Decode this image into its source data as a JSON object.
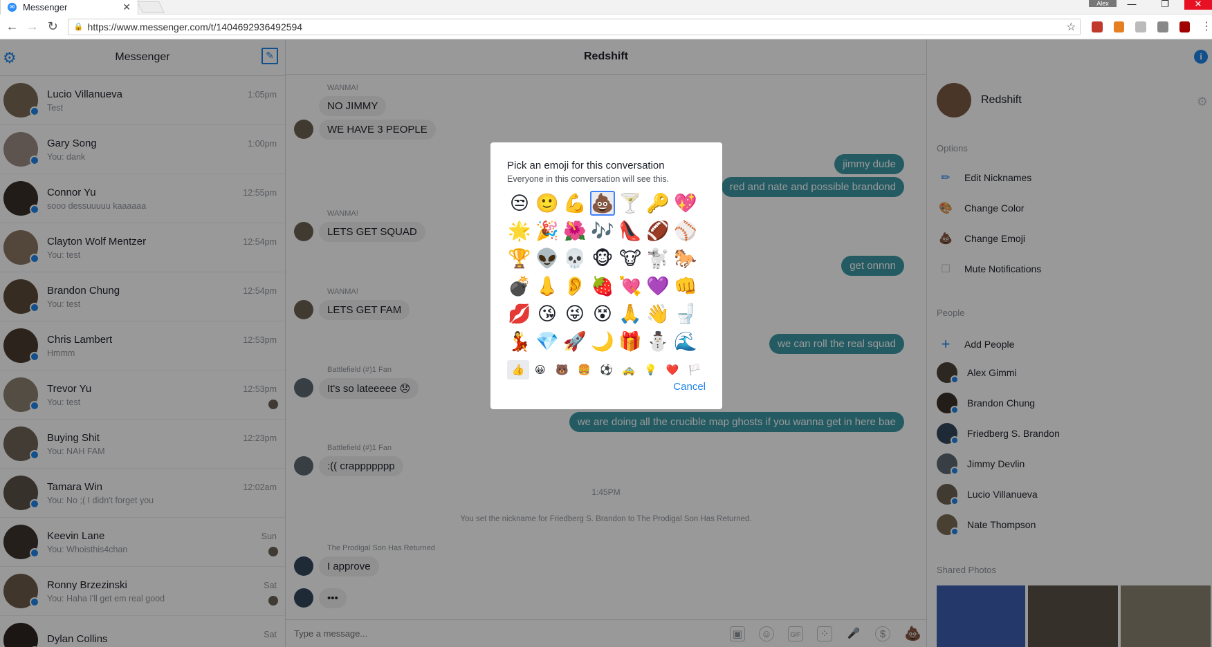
{
  "browser": {
    "tab_title": "Messenger",
    "profile_label": "Alex",
    "url": "https://www.messenger.com/t/1404692936492594"
  },
  "sidebar": {
    "title": "Messenger",
    "conversations": [
      {
        "name": "Lucio Villanueva",
        "snippet": "Test",
        "time": "1:05pm"
      },
      {
        "name": "Gary Song",
        "snippet": "You: dank",
        "time": "1:00pm"
      },
      {
        "name": "Connor Yu",
        "snippet": "sooo dessuuuuu kaaaaaa",
        "time": "12:55pm"
      },
      {
        "name": "Clayton Wolf Mentzer",
        "snippet": "You: test",
        "time": "12:54pm"
      },
      {
        "name": "Brandon Chung",
        "snippet": "You: test",
        "time": "12:54pm"
      },
      {
        "name": "Chris Lambert",
        "snippet": "Hmmm",
        "time": "12:53pm"
      },
      {
        "name": "Trevor Yu",
        "snippet": "You: test",
        "time": "12:53pm"
      },
      {
        "name": "Buying Shit",
        "snippet": "You: NAH FAM",
        "time": "12:23pm"
      },
      {
        "name": "Tamara Win",
        "snippet": "You: No ;( I didn't forget you",
        "time": "12:02am"
      },
      {
        "name": "Keevin Lane",
        "snippet": "You: Whoisthis4chan",
        "time": "Sun"
      },
      {
        "name": "Ronny Brzezinski",
        "snippet": "You: Haha I'll get em real good",
        "time": "Sat"
      },
      {
        "name": "Dylan Collins",
        "snippet": "",
        "time": "Sat"
      }
    ]
  },
  "chat": {
    "title": "Redshift",
    "messages": {
      "s1": "WANMA!",
      "m1": "NO JIMMY",
      "m2": "WE HAVE 3 PEOPLE",
      "o1": "jimmy dude",
      "o2": "red and nate and possible brandond",
      "s2": "WANMA!",
      "m3": "LETS GET SQUAD",
      "o3": "get onnnn",
      "s3": "WANMA!",
      "m4": "LETS GET FAM",
      "o4": "we can roll the real squad",
      "s4": "Battlefield (#)1 Fan",
      "m5": "It's so lateeeee 😞",
      "o5": "we are doing all the crucible map ghosts if you wanna get in here bae",
      "s5": "Battlefield (#)1 Fan",
      "m6": ":(( crappppppp",
      "ts": "1:45PM",
      "sys": "You set the nickname for Friedberg S. Brandon to The Prodigal Son Has Returned.",
      "s6": "The Prodigal Son Has Returned",
      "m7": "I approve",
      "typing": "•••"
    },
    "composer_placeholder": "Type a message..."
  },
  "info": {
    "name": "Redshift",
    "options_title": "Options",
    "options": [
      "Edit Nicknames",
      "Change Color",
      "Change Emoji",
      "Mute Notifications"
    ],
    "people_title": "People",
    "add_people": "Add People",
    "people": [
      "Alex Gimmi",
      "Brandon Chung",
      "Friedberg S. Brandon",
      "Jimmy Devlin",
      "Lucio Villanueva",
      "Nate Thompson"
    ],
    "photos_title": "Shared Photos"
  },
  "modal": {
    "title": "Pick an emoji for this conversation",
    "subtitle": "Everyone in this conversation will see this.",
    "emojis": [
      "😒",
      "🙂",
      "💪",
      "💩",
      "🍸",
      "🔑",
      "💖",
      "🌟",
      "🎉",
      "🌺",
      "🎶",
      "👠",
      "🏈",
      "⚾",
      "🏆",
      "👽",
      "💀",
      "🐵",
      "🐮",
      "🐩",
      "🐎",
      "💣",
      "👃",
      "👂",
      "🍓",
      "💘",
      "💜",
      "👊",
      "💋",
      "😘",
      "😜",
      "😵",
      "🙏",
      "👋",
      "🚽",
      "💃",
      "💎",
      "🚀",
      "🌙",
      "🎁",
      "⛄",
      "🌊"
    ],
    "categories": [
      "👍",
      "😀",
      "🐻",
      "🍔",
      "⚽",
      "🚕",
      "💡",
      "❤️",
      "🏳️"
    ],
    "cancel": "Cancel"
  },
  "colors": {
    "brand": "#1f84e8",
    "outgoing_bubble": "#3c98a5",
    "incoming_bubble": "#f1f0f0"
  }
}
